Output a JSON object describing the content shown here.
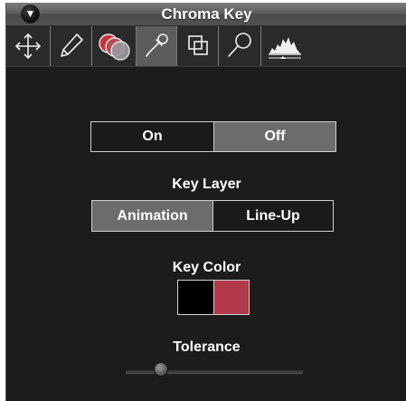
{
  "window": {
    "title": "Chroma Key"
  },
  "toolbar": {
    "tools": [
      {
        "name": "move",
        "icon": "move-arrows-icon",
        "active": false
      },
      {
        "name": "pencil",
        "icon": "pencil-icon",
        "active": false
      },
      {
        "name": "chroma-key",
        "icon": "chroma-circles-icon",
        "active": false
      },
      {
        "name": "eyedropper",
        "icon": "eyedropper-icon",
        "active": true
      },
      {
        "name": "layers",
        "icon": "overlapping-squares-icon",
        "active": false
      },
      {
        "name": "magnify",
        "icon": "magnifier-icon",
        "active": false
      },
      {
        "name": "histogram",
        "icon": "histogram-icon",
        "active": false
      }
    ]
  },
  "onoff": {
    "on_label": "On",
    "off_label": "Off",
    "selected": "Off"
  },
  "key_layer": {
    "label": "Key Layer",
    "options": [
      "Animation",
      "Line-Up"
    ],
    "selected": "Animation"
  },
  "key_color": {
    "label": "Key Color",
    "colors": [
      "#000000",
      "#b03a4a"
    ]
  },
  "tolerance": {
    "label": "Tolerance",
    "value": 0.2
  },
  "colors": {
    "panel_bg": "#1c1c1c",
    "selected_segment": "#6c6c6c",
    "active_tool": "#5c5c5c"
  }
}
